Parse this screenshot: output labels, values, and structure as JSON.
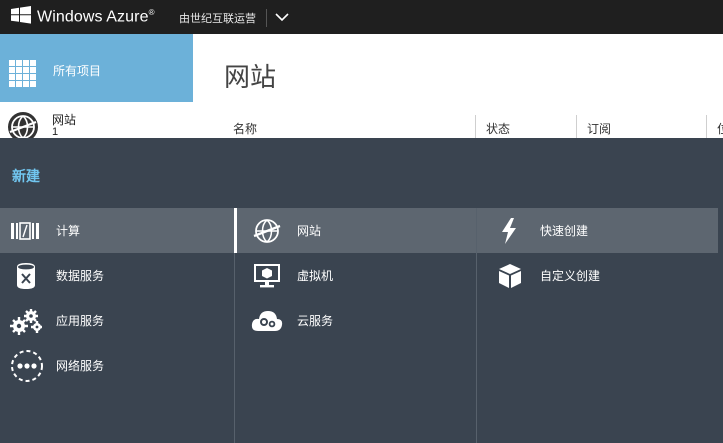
{
  "topbar": {
    "brand": "Windows Azure",
    "brand_mark": "®",
    "tenant": "由世纪互联运营"
  },
  "sidebar": {
    "all_items": {
      "label": "所有项目",
      "icon": "grid-icon"
    },
    "websites": {
      "label": "网站",
      "count": "1",
      "icon": "globe-icon"
    }
  },
  "main": {
    "title": "网站",
    "columns": [
      "名称",
      "状态",
      "订阅",
      "位"
    ]
  },
  "new_panel": {
    "title": "新建",
    "col1": [
      {
        "label": "计算",
        "icon": "compute-icon",
        "selected": true
      },
      {
        "label": "数据服务",
        "icon": "data-services-icon",
        "selected": false
      },
      {
        "label": "应用服务",
        "icon": "app-services-icon",
        "selected": false
      },
      {
        "label": "网络服务",
        "icon": "network-services-icon",
        "selected": false
      }
    ],
    "col2": [
      {
        "label": "网站",
        "icon": "website-globe-icon",
        "selected": true
      },
      {
        "label": "虚拟机",
        "icon": "virtual-machine-icon",
        "selected": false
      },
      {
        "label": "云服务",
        "icon": "cloud-service-icon",
        "selected": false
      }
    ],
    "col3": [
      {
        "label": "快速创建",
        "icon": "lightning-icon",
        "selected": true
      },
      {
        "label": "自定义创建",
        "icon": "package-icon",
        "selected": false
      }
    ]
  },
  "colors": {
    "topbar_bg": "#1f1f1f",
    "all_items_bg": "#6cb1d9",
    "panel_bg": "#3a4450",
    "selected_bg": "#5d6670",
    "new_title": "#71c6f0"
  }
}
